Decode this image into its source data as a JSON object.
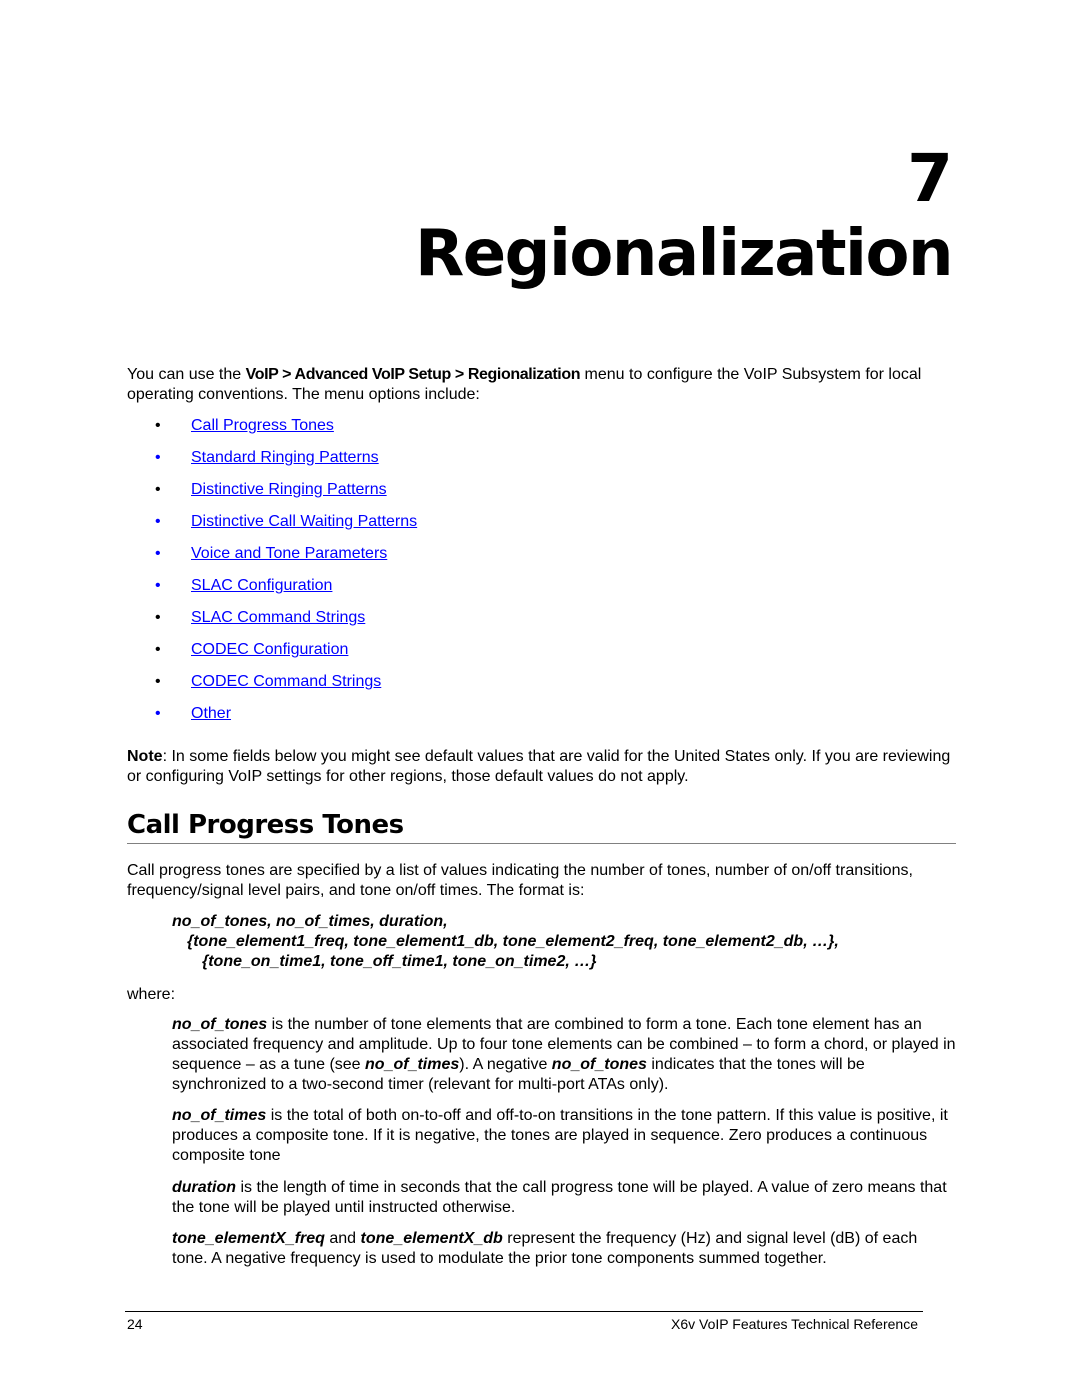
{
  "chapter": {
    "number": "7",
    "title": "Regionalization"
  },
  "intro": {
    "prefix": "You can use the ",
    "menu_path": "VoIP > Advanced VoIP Setup > Regionalization",
    "suffix": " menu to configure the VoIP Subsystem for local operating conventions. The menu options include:"
  },
  "menu_options": [
    {
      "label": "Call Progress Tones",
      "bullet_color": "black"
    },
    {
      "label": "Standard Ringing Patterns",
      "bullet_color": "blue"
    },
    {
      "label": "Distinctive Ringing Patterns",
      "bullet_color": "black"
    },
    {
      "label": "Distinctive Call Waiting Patterns",
      "bullet_color": "blue"
    },
    {
      "label": "Voice and Tone Parameters",
      "bullet_color": "blue"
    },
    {
      "label": "SLAC Configuration",
      "bullet_color": "blue"
    },
    {
      "label": "SLAC Command Strings",
      "bullet_color": "black"
    },
    {
      "label": "CODEC Configuration",
      "bullet_color": "black"
    },
    {
      "label": "CODEC Command Strings",
      "bullet_color": "black"
    },
    {
      "label": "Other",
      "bullet_color": "blue"
    }
  ],
  "note": {
    "label": "Note",
    "text": ": In some fields below you might see default values that are valid for the United States only. If you are reviewing or configuring VoIP settings for other regions, those default values do not apply."
  },
  "section": {
    "title": "Call Progress Tones",
    "intro": "Call progress tones are specified by a list of values indicating the number of tones, number of on/off transitions, frequency/signal level pairs, and tone on/off times. The format is:",
    "syntax": [
      "no_of_tones, no_of_times, duration,",
      "{tone_element1_freq, tone_element1_db, tone_element2_freq, tone_element2_db, …},",
      "{tone_on_time1, tone_off_time1, tone_on_time2, …}"
    ],
    "where": "where:",
    "definitions": {
      "no_of_tones": {
        "term": "no_of_tones",
        "t1": " is the number of tone elements that are combined to form a tone. Each tone element has an associated frequency and amplitude. Up to four tone elements can be combined – to form a chord, or played in sequence – as a tune (see ",
        "ref1": "no_of_times",
        "t2": "). A negative ",
        "ref2": "no_of_tones",
        "t3": " indicates that the tones will be synchronized to a two-second timer (relevant for multi-port ATAs only)."
      },
      "no_of_times": {
        "term": "no_of_times",
        "text": " is the total of both on-to-off and off-to-on transitions in the tone pattern. If this value is positive, it produces a composite tone. If it is negative, the tones are played in sequence. Zero produces a continuous composite tone"
      },
      "duration": {
        "term": "duration",
        "text": " is the length of time in seconds that the call progress tone will be played. A value of zero means that the tone will be played until instructed otherwise."
      },
      "tone_element": {
        "term1": "tone_elementX_freq",
        "mid": " and ",
        "term2": "tone_elementX_db",
        "text": " represent the frequency (Hz) and signal level (dB) of each tone. A negative frequency is used to modulate the prior tone components summed together."
      }
    }
  },
  "footer": {
    "page_number": "24",
    "doc_title": "X6v VoIP Features Technical Reference"
  },
  "colors": {
    "link": "#0000ff",
    "text": "#000000",
    "rule": "#808080"
  }
}
